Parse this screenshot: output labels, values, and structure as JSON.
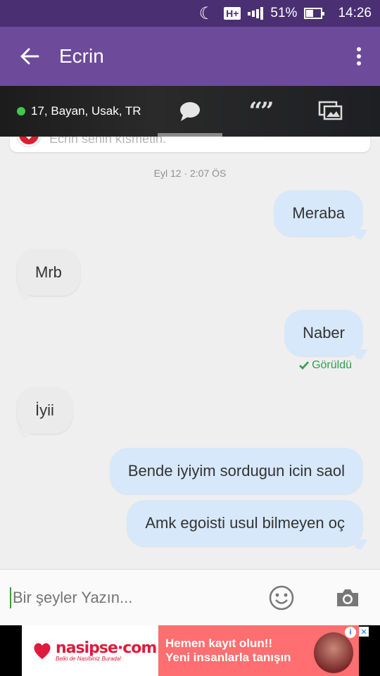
{
  "status_bar": {
    "network": "H+",
    "battery": "51%",
    "battery_level": 0.51,
    "time": "14:26",
    "icons": [
      "moon-icon",
      "h-plus-icon",
      "signal-icon",
      "battery-icon"
    ]
  },
  "header": {
    "title": "Ecrin",
    "back_icon": "arrow-left-icon",
    "menu_icon": "more-vertical-icon",
    "background_color": "#6d4a9a"
  },
  "profile_strip": {
    "info": "17, Bayan, Usak, TR",
    "online_color": "#3ec94a",
    "tabs": [
      {
        "icon": "chat-bubble-icon",
        "active": true
      },
      {
        "icon": "quote-icon",
        "glyph": "“”",
        "active": false
      },
      {
        "icon": "photos-icon",
        "active": false
      }
    ]
  },
  "chat": {
    "match_text": "Ecrin senin kısmetin.",
    "date": "Eyl 12 · 2:07 ÖS",
    "messages": [
      {
        "direction": "out",
        "text": "Meraba"
      },
      {
        "direction": "in",
        "text": "Mrb"
      },
      {
        "direction": "out",
        "text": "Naber"
      },
      {
        "direction": "in",
        "text": "İyii"
      },
      {
        "direction": "out",
        "text": "Bende iyiyim sordugun icin saol"
      },
      {
        "direction": "out",
        "text": "Amk egoisti usul bilmeyen oç"
      }
    ],
    "seen_label": "Görüldü",
    "seen_icon": "check-icon"
  },
  "composer": {
    "placeholder": "Bir şeyler Yazın...",
    "emoji_icon": "smiley-icon",
    "camera_icon": "camera-icon"
  },
  "ad": {
    "brand": "nasipse·com",
    "tagline": "Belki de Nasibiniz Burada!",
    "line1": "Hemen kayıt olun!!",
    "line2": "Yeni insanlarla tanışın",
    "info_icon": "info-icon",
    "close_icon": "close-icon"
  }
}
